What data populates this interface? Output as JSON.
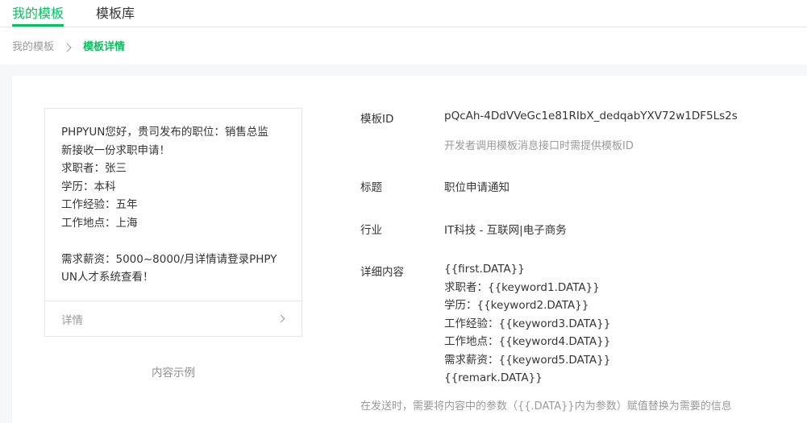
{
  "tabs": [
    {
      "label": "我的模板",
      "active": true
    },
    {
      "label": "模板库",
      "active": false
    }
  ],
  "breadcrumb": {
    "parent": "我的模板",
    "current": "模板详情"
  },
  "preview": {
    "lines": [
      "PHPYUN您好，贵司发布的职位：销售总监",
      "新接收一份求职申请！",
      "求职者：张三",
      "学历：本科",
      "工作经验：五年",
      "工作地点：上海",
      "",
      "需求薪资：5000~8000/月详情请登录PHPY",
      "UN人才系统查看！"
    ],
    "footer_label": "详情",
    "caption": "内容示例"
  },
  "details": {
    "template_id_label": "模板ID",
    "template_id_value": "pQcAh-4DdVVeGc1e81RIbX_dedqabYXV72w1DF5Ls2s",
    "template_id_hint": "开发者调用模板消息接口时需提供模板ID",
    "title_label": "标题",
    "title_value": "职位申请通知",
    "industry_label": "行业",
    "industry_value": "IT科技 - 互联网|电子商务",
    "content_label": "详细内容",
    "content_lines": [
      "{{first.DATA}}",
      "求职者：{{keyword1.DATA}}",
      "学历：{{keyword2.DATA}}",
      "工作经验：{{keyword3.DATA}}",
      "工作地点：{{keyword4.DATA}}",
      "需求薪资：{{keyword5.DATA}}",
      "{{remark.DATA}}"
    ],
    "footnote": "在发送时，需要将内容中的参数（{{.DATA}}内为参数）赋值替换为需要的信息"
  },
  "colors": {
    "accent": "#07c160",
    "text": "#353535",
    "muted": "#9a9a9a",
    "band": "#f6f7f9"
  }
}
